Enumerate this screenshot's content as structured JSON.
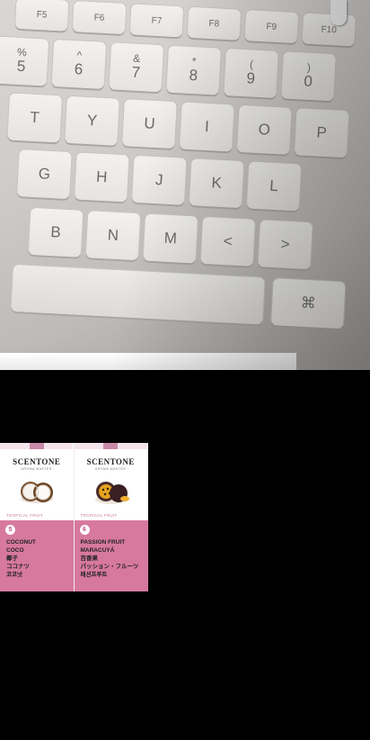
{
  "keyboard": {
    "function_row": [
      "F5",
      "F6",
      "F7",
      "F8",
      "F9",
      "F10"
    ],
    "number_row": [
      {
        "top": "%",
        "bottom": "5"
      },
      {
        "top": "^",
        "bottom": "6"
      },
      {
        "top": "&",
        "bottom": "7"
      },
      {
        "top": "*",
        "bottom": "8"
      },
      {
        "top": "(",
        "bottom": "9"
      },
      {
        "top": ")",
        "bottom": "0"
      }
    ],
    "top_row": [
      "T",
      "Y",
      "U",
      "I",
      "O",
      "P"
    ],
    "home_row": [
      "G",
      "H",
      "J",
      "K",
      "L"
    ],
    "bottom_row": [
      "B",
      "N",
      "M",
      "<",
      ">"
    ],
    "command_symbol": "⌘"
  },
  "cards": [
    {
      "brand": "SCENTONE",
      "tagline": "· AROMA MASTER ·",
      "category": "TROPICAL FRUIT",
      "number": "5",
      "names": [
        "COCONUT",
        "COCO",
        "椰子",
        "ココナツ",
        "코코넛"
      ],
      "fruit_icon": "coconut-icon"
    },
    {
      "brand": "SCENTONE",
      "tagline": "· AROMA MASTER ·",
      "category": "TROPICAL FRUIT",
      "number": "6",
      "names": [
        "PASSION FRUIT",
        "MARACUYÁ",
        "百香果",
        "パッション・フルーツ",
        "패션프루트"
      ],
      "fruit_icon": "passion-fruit-icon"
    }
  ],
  "colors": {
    "card_panel": "#d7799e",
    "card_stripe": "#c88aa8",
    "background": "#000000"
  }
}
